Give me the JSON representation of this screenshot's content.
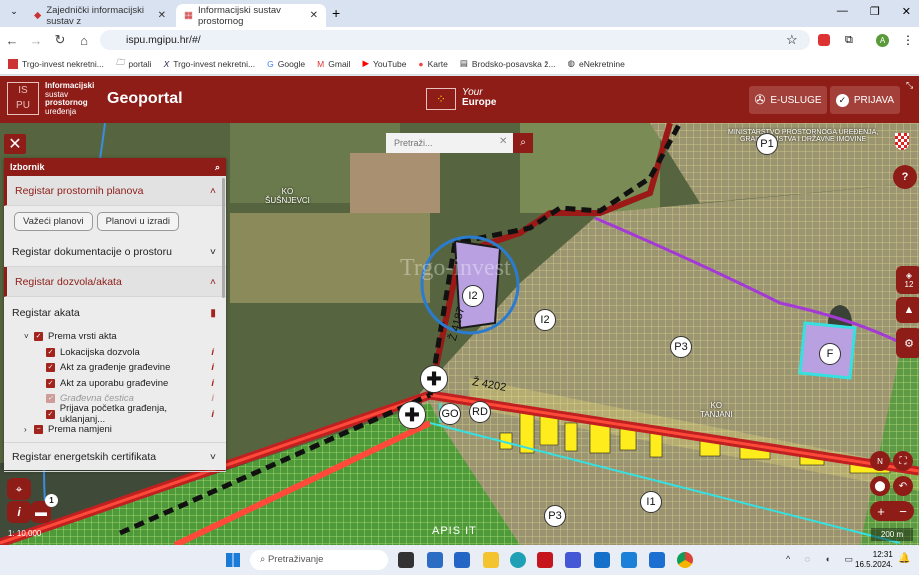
{
  "browser": {
    "tabs": [
      {
        "title": "Zajednički informacijski sustav z"
      },
      {
        "title": "Informacijski sustav prostornog"
      }
    ],
    "url": "ispu.mgipu.hr/#/",
    "bookmarks": [
      "Trgo-invest nekretni...",
      "portali",
      "Trgo-invest nekretni...",
      "Google",
      "Gmail",
      "YouTube",
      "Karte",
      "Brodsko-posavska ž...",
      "eNekretnine"
    ]
  },
  "header": {
    "logo_lines": [
      "Informacijski",
      "sustav",
      "prostornog",
      "uređenja"
    ],
    "title": "Geoportal",
    "your_europe": [
      "Your",
      "Europe"
    ],
    "eusluge": "E-USLUGE",
    "prijava": "PRIJAVA"
  },
  "search": {
    "placeholder": "Pretraži..."
  },
  "panel": {
    "title": "Izbornik",
    "sections": {
      "planovi": "Registar prostornih planova",
      "btn1": "Važeći planovi",
      "btn2": "Planovi u izradi",
      "dokumentacija": "Registar dokumentacije o prostoru",
      "dozvole": "Registar dozvola/akata",
      "akata": "Registar akata",
      "energ": "Registar energetskih certifikata"
    },
    "tree": {
      "group1": "Prema vrsti akta",
      "items": [
        "Lokacijska dozvola",
        "Akt za građenje građevine",
        "Akt za uporabu građevine",
        "Građevna čestica",
        "Prijava početka građenja, uklanjanj..."
      ],
      "group2": "Prema namjeni"
    }
  },
  "map": {
    "labels": {
      "ko1": "KO",
      "sus": "ŠUŠNJEVCI",
      "ko2": "KO",
      "tan": "TANJANI",
      "ministry1": "MINISTARSTVO PROSTORNOGA UREĐENJA,",
      "ministry2": "GRADITELJSTVA I DRŽAVNE IMOVINE",
      "road1": "Ž 4202",
      "road2": "Ž 4187",
      "watermark": "Trgo-invest"
    },
    "markers": [
      "P1",
      "I2",
      "I2",
      "P3",
      "F",
      "GO",
      "RD",
      "I1",
      "P3"
    ],
    "layers_count": "12",
    "scale": "1: 10,000",
    "scalebar": "200 m",
    "badge": "1",
    "brand": "APIS IT"
  },
  "taskbar": {
    "search": "Pretraživanje",
    "time": "12:31",
    "date": "16.5.2024."
  },
  "colors": {
    "brand": "#8e1c17"
  }
}
